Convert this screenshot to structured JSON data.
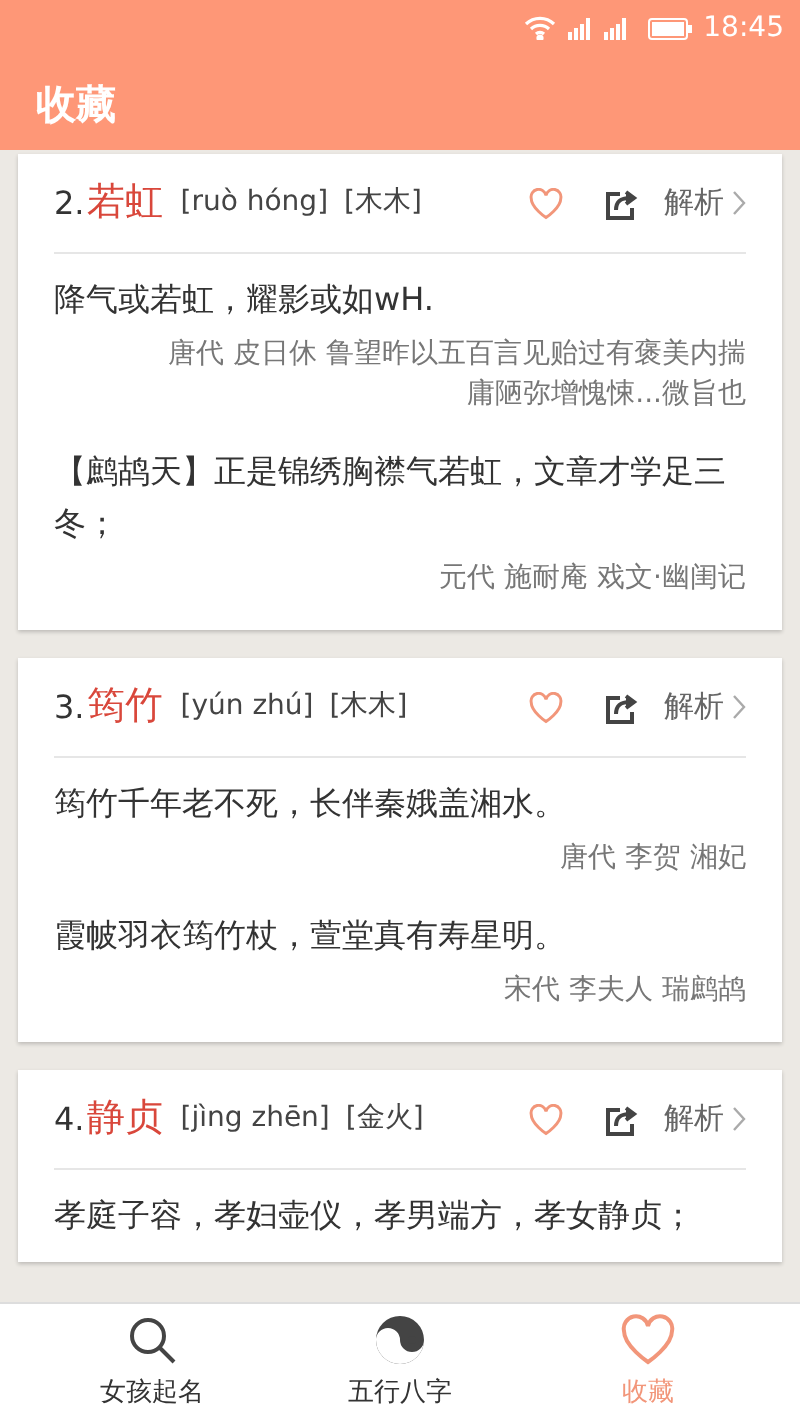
{
  "status_bar": {
    "time": "18:45"
  },
  "header": {
    "title": "收藏"
  },
  "cards": [
    {
      "index": "2.",
      "name": "若虹",
      "pinyin": "[ruò hóng]",
      "elements": "[木木]",
      "action": "解析",
      "quotes": [
        {
          "text": "降气或若虹，耀影或如wH.",
          "source": "唐代 皮日休 鲁望昨以五百言见贻过有褒美内揣庸陋弥增愧悚...微旨也"
        },
        {
          "text": "【鹧鸪天】正是锦绣胸襟气若虹，文章才学足三冬；",
          "source": "元代 施耐庵 戏文·幽闺记"
        }
      ]
    },
    {
      "index": "3.",
      "name": "筠竹",
      "pinyin": "[yún zhú]",
      "elements": "[木木]",
      "action": "解析",
      "quotes": [
        {
          "text": "筠竹千年老不死，长伴秦娥盖湘水。",
          "source": "唐代 李贺 湘妃"
        },
        {
          "text": "霞帔羽衣筠竹杖，萱堂真有寿星明。",
          "source": "宋代 李夫人 瑞鹧鸪"
        }
      ]
    },
    {
      "index": "4.",
      "name": "静贞",
      "pinyin": "[jìng zhēn]",
      "elements": "[金火]",
      "action": "解析",
      "quotes": [
        {
          "text": "孝庭子容，孝妇壶仪，孝男端方，孝女静贞；"
        }
      ]
    }
  ],
  "tabs": [
    {
      "kind": "search",
      "label": "女孩起名",
      "selected": false
    },
    {
      "kind": "yinyang",
      "label": "五行八字",
      "selected": false
    },
    {
      "kind": "heart",
      "label": "收藏",
      "selected": true
    }
  ]
}
